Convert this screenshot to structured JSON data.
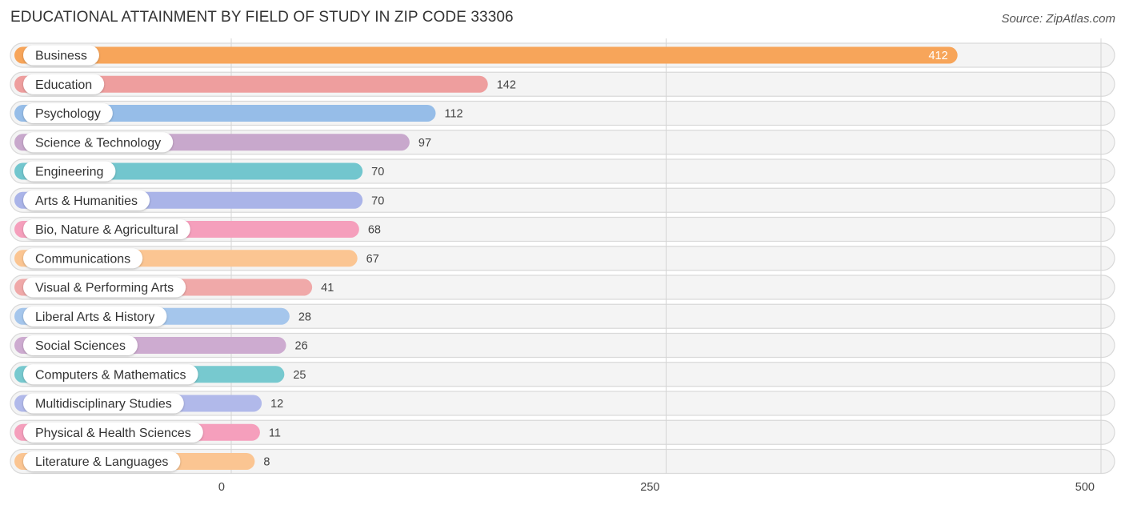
{
  "header": {
    "title": "EDUCATIONAL ATTAINMENT BY FIELD OF STUDY IN ZIP CODE 33306",
    "source": "Source: ZipAtlas.com"
  },
  "chart_data": {
    "type": "bar",
    "orientation": "horizontal",
    "title": "EDUCATIONAL ATTAINMENT BY FIELD OF STUDY IN ZIP CODE 33306",
    "xlabel": "",
    "ylabel": "",
    "xlim": [
      0,
      500
    ],
    "xticks": [
      0,
      250,
      500
    ],
    "xtick_labels": [
      "0",
      "250",
      "500"
    ],
    "grid": true,
    "categories": [
      "Business",
      "Education",
      "Psychology",
      "Science & Technology",
      "Engineering",
      "Arts & Humanities",
      "Bio, Nature & Agricultural",
      "Communications",
      "Visual & Performing Arts",
      "Liberal Arts & History",
      "Social Sciences",
      "Computers & Mathematics",
      "Multidisciplinary Studies",
      "Physical & Health Sciences",
      "Literature & Languages"
    ],
    "values": [
      412,
      142,
      112,
      97,
      70,
      70,
      68,
      67,
      41,
      28,
      26,
      25,
      12,
      11,
      8
    ],
    "colors": [
      "#f7a55a",
      "#ee9e9e",
      "#96bde8",
      "#c8a8cc",
      "#72c6ce",
      "#aab4e8",
      "#f59fbc",
      "#fbc592",
      "#f0a9a9",
      "#a5c6ec",
      "#cdabd0",
      "#77c9cf",
      "#b1b9ea",
      "#f59fbc",
      "#fbc592"
    ]
  }
}
